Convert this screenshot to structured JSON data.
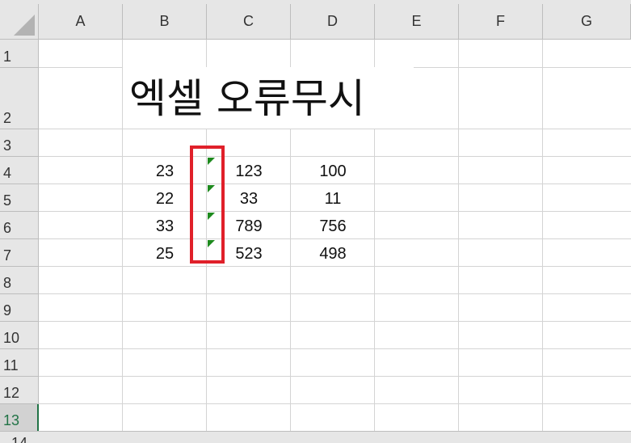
{
  "columns": [
    "A",
    "B",
    "C",
    "D",
    "E",
    "F",
    "G"
  ],
  "rows": [
    "1",
    "2",
    "3",
    "4",
    "5",
    "6",
    "7",
    "8",
    "9",
    "10",
    "11",
    "12",
    "13",
    "14"
  ],
  "active_row": "13",
  "title": "엑셀 오류무시",
  "data_rows": [
    {
      "b": "23",
      "c": "123",
      "d": "100"
    },
    {
      "b": "22",
      "c": "33",
      "d": "11"
    },
    {
      "b": "33",
      "c": "789",
      "d": "756"
    },
    {
      "b": "25",
      "c": "523",
      "d": "498"
    }
  ],
  "colors": {
    "error_flag": "#1e8a1e",
    "highlight_box": "#e0202a",
    "active_row_header": "#217346"
  }
}
